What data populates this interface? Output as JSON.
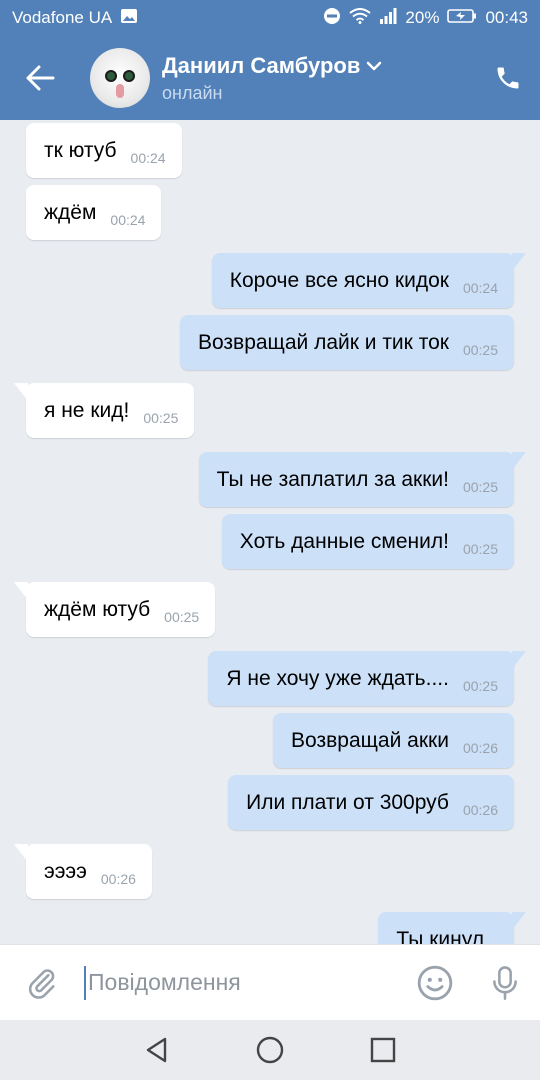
{
  "status_bar": {
    "carrier": "Vodafone UA",
    "battery": "20%",
    "time": "00:43"
  },
  "header": {
    "contact_name": "Даниил Самбуров",
    "status": "онлайн"
  },
  "messages": [
    {
      "dir": "in",
      "text": "тк ютуб",
      "time": "00:24"
    },
    {
      "dir": "in",
      "text": "ждём",
      "time": "00:24"
    },
    {
      "dir": "out",
      "text": "Короче все ясно кидок",
      "time": "00:24"
    },
    {
      "dir": "out",
      "text": "Возвращай лайк и тик ток",
      "time": "00:25"
    },
    {
      "dir": "in",
      "text": "я не кид!",
      "time": "00:25"
    },
    {
      "dir": "out",
      "text": "Ты не заплатил за акки!",
      "time": "00:25"
    },
    {
      "dir": "out",
      "text": "Хоть данные сменил!",
      "time": "00:25"
    },
    {
      "dir": "in",
      "text": "ждём ютуб",
      "time": "00:25"
    },
    {
      "dir": "out",
      "text": "Я не хочу уже ждать....",
      "time": "00:25"
    },
    {
      "dir": "out",
      "text": "Возвращай акки",
      "time": "00:26"
    },
    {
      "dir": "out",
      "text": "Или плати от 300руб",
      "time": "00:26"
    },
    {
      "dir": "in",
      "text": "ээээ",
      "time": "00:26"
    },
    {
      "dir": "out",
      "text": "Ты кинул",
      "time": ""
    }
  ],
  "composer": {
    "placeholder": "Повідомлення"
  },
  "colors": {
    "accent": "#5181b8",
    "outgoing_bubble": "#cce0f8",
    "incoming_bubble": "#ffffff",
    "background": "#e9edf2"
  }
}
